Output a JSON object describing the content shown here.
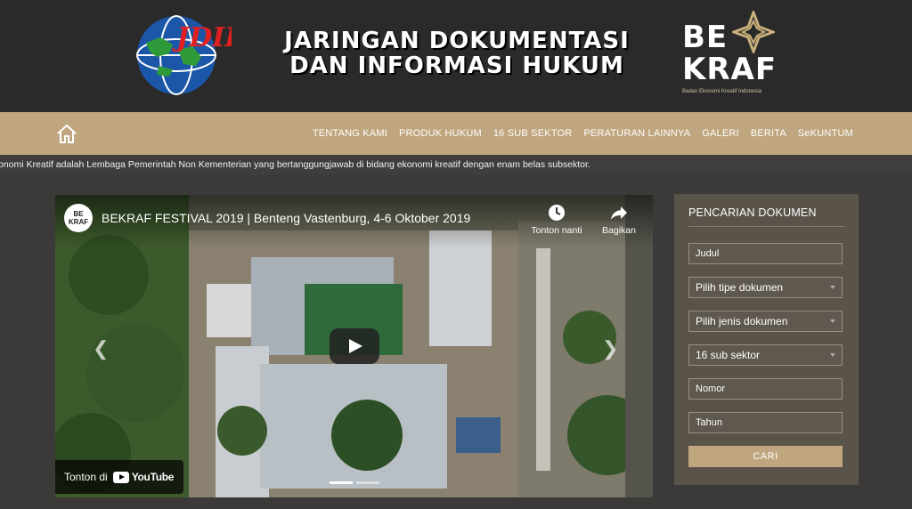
{
  "header": {
    "jdih_logo_text": "JDIH",
    "title_line1": "JARINGAN DOKUMENTASI",
    "title_line2": "DAN INFORMASI HUKUM",
    "bekraf_logo_text_line1": "BE",
    "bekraf_logo_text_line2": "KRAF",
    "bekraf_tagline": "Badan Ekonomi Kreatif Indonesia"
  },
  "nav": {
    "items": [
      {
        "label": "TENTANG KAMI"
      },
      {
        "label": "PRODUK HUKUM"
      },
      {
        "label": "16 SUB SEKTOR"
      },
      {
        "label": "PERATURAN LAINNYA"
      },
      {
        "label": "GALERI"
      },
      {
        "label": "BERITA"
      },
      {
        "label": "SeKUNTUM"
      }
    ]
  },
  "ticker": {
    "text": "onomi Kreatif adalah Lembaga Pemerintah Non Kementerian yang bertanggungjawab di bidang ekonomi kreatif dengan enam belas subsektor."
  },
  "video": {
    "channel_avatar_text": "BE KRAF",
    "title": "BEKRAF FESTIVAL 2019 | Benteng Vastenburg, 4-6 Oktober 2019",
    "watch_later": "Tonton nanti",
    "share": "Bagikan",
    "watch_on": "Tonton di",
    "youtube": "YouTube",
    "icons": {
      "watch_later": "clock-icon",
      "share": "share-arrow-icon",
      "play": "play-icon"
    }
  },
  "search": {
    "title": "PENCARIAN DOKUMEN",
    "judul_placeholder": "Judul",
    "tipe_selected": "Pilih tipe dokumen",
    "jenis_selected": "Pilih jenis dokumen",
    "subsektor_selected": "16 sub sektor",
    "nomor_placeholder": "Nomor",
    "tahun_placeholder": "Tahun",
    "submit_label": "CARI"
  },
  "colors": {
    "header_bg": "#2a2a2a",
    "nav_bg": "#bfa67e",
    "page_bg": "#3b3a38",
    "panel_bg": "#5a534a",
    "accent": "#bfa67e"
  }
}
